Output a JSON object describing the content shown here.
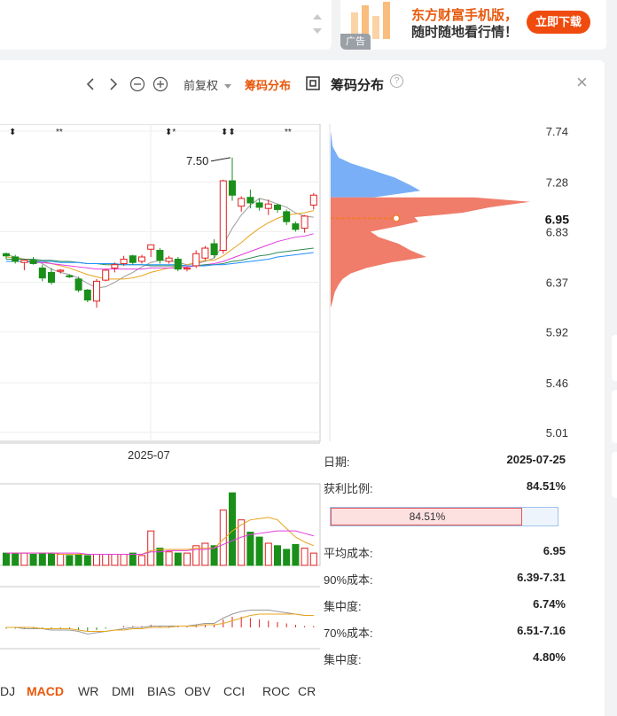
{
  "ad": {
    "line1": "东方财富手机版，",
    "line2": "随时随地看行情！",
    "button": "立即下载",
    "tag": "广告"
  },
  "toolbar": {
    "prev_icon": "chevron-left-icon",
    "next_icon": "chevron-right-icon",
    "zoom_out_icon": "zoom-out-icon",
    "zoom_in_icon": "zoom-in-icon",
    "adjust_label": "前复权",
    "chip_toggle_label": "筹码分布",
    "fullscreen_icon": "fullscreen-icon",
    "chip_title": "筹码分布",
    "help_icon": "?",
    "close_icon": "×",
    "accent_color": "#e8590c"
  },
  "chart_data": [
    {
      "type": "candlestick",
      "x_tick_labels": [
        "2025-07"
      ],
      "y_tick_labels": [
        "7.74",
        "7.28",
        "6.83",
        "6.37",
        "5.92",
        "5.46",
        "5.01"
      ],
      "current_price_label": "6.95",
      "annotation": "7.50",
      "ylim": [
        5.01,
        7.74
      ],
      "candles": [
        {
          "o": 6.63,
          "h": 6.64,
          "l": 6.58,
          "c": 6.61
        },
        {
          "o": 6.6,
          "h": 6.62,
          "l": 6.54,
          "c": 6.56
        },
        {
          "o": 6.55,
          "h": 6.58,
          "l": 6.48,
          "c": 6.57
        },
        {
          "o": 6.57,
          "h": 6.6,
          "l": 6.53,
          "c": 6.54
        },
        {
          "o": 6.5,
          "h": 6.53,
          "l": 6.38,
          "c": 6.41
        },
        {
          "o": 6.46,
          "h": 6.5,
          "l": 6.35,
          "c": 6.37
        },
        {
          "o": 6.47,
          "h": 6.49,
          "l": 6.45,
          "c": 6.48
        },
        {
          "o": 6.43,
          "h": 6.44,
          "l": 6.41,
          "c": 6.42
        },
        {
          "o": 6.4,
          "h": 6.42,
          "l": 6.28,
          "c": 6.3
        },
        {
          "o": 6.3,
          "h": 6.31,
          "l": 6.19,
          "c": 6.21
        },
        {
          "o": 6.2,
          "h": 6.4,
          "l": 6.14,
          "c": 6.38
        },
        {
          "o": 6.39,
          "h": 6.49,
          "l": 6.38,
          "c": 6.48
        },
        {
          "o": 6.5,
          "h": 6.55,
          "l": 6.46,
          "c": 6.53
        },
        {
          "o": 6.54,
          "h": 6.61,
          "l": 6.52,
          "c": 6.58
        },
        {
          "o": 6.61,
          "h": 6.62,
          "l": 6.53,
          "c": 6.55
        },
        {
          "o": 6.56,
          "h": 6.62,
          "l": 6.54,
          "c": 6.6
        },
        {
          "o": 6.67,
          "h": 6.71,
          "l": 6.6,
          "c": 6.71
        },
        {
          "o": 6.66,
          "h": 6.68,
          "l": 6.54,
          "c": 6.57
        },
        {
          "o": 6.56,
          "h": 6.61,
          "l": 6.54,
          "c": 6.59
        },
        {
          "o": 6.58,
          "h": 6.6,
          "l": 6.47,
          "c": 6.49
        },
        {
          "o": 6.49,
          "h": 6.51,
          "l": 6.47,
          "c": 6.5
        },
        {
          "o": 6.52,
          "h": 6.66,
          "l": 6.5,
          "c": 6.63
        },
        {
          "o": 6.59,
          "h": 6.7,
          "l": 6.57,
          "c": 6.68
        },
        {
          "o": 6.72,
          "h": 6.76,
          "l": 6.59,
          "c": 6.62
        },
        {
          "o": 6.66,
          "h": 7.3,
          "l": 6.63,
          "c": 7.29
        },
        {
          "o": 7.29,
          "h": 7.5,
          "l": 7.11,
          "c": 7.16
        },
        {
          "o": 7.06,
          "h": 7.15,
          "l": 7.01,
          "c": 7.13
        },
        {
          "o": 7.14,
          "h": 7.21,
          "l": 7.04,
          "c": 7.09
        },
        {
          "o": 7.09,
          "h": 7.13,
          "l": 7.02,
          "c": 7.05
        },
        {
          "o": 7.04,
          "h": 7.12,
          "l": 6.98,
          "c": 7.08
        },
        {
          "o": 7.07,
          "h": 7.08,
          "l": 7.0,
          "c": 7.03
        },
        {
          "o": 7.01,
          "h": 7.03,
          "l": 6.89,
          "c": 6.92
        },
        {
          "o": 6.9,
          "h": 6.92,
          "l": 6.83,
          "c": 6.85
        },
        {
          "o": 6.86,
          "h": 6.98,
          "l": 6.82,
          "c": 6.97
        },
        {
          "o": 7.07,
          "h": 7.18,
          "l": 7.03,
          "c": 7.16
        }
      ],
      "moving_averages": [
        {
          "color": "#999999",
          "values": [
            6.62,
            6.6,
            6.58,
            6.57,
            6.54,
            6.49,
            6.46,
            6.44,
            6.41,
            6.36,
            6.32,
            6.33,
            6.37,
            6.42,
            6.46,
            6.51,
            6.55,
            6.57,
            6.57,
            6.55,
            6.53,
            6.54,
            6.56,
            6.59,
            6.71,
            6.86,
            6.98,
            7.07,
            7.13,
            7.11,
            7.08,
            7.05,
            7.0,
            6.97,
            6.96
          ]
        },
        {
          "color": "#e8a41c",
          "values": [
            6.6,
            6.59,
            6.58,
            6.57,
            6.56,
            6.54,
            6.52,
            6.5,
            6.47,
            6.44,
            6.42,
            6.4,
            6.4,
            6.4,
            6.41,
            6.43,
            6.46,
            6.48,
            6.5,
            6.51,
            6.53,
            6.55,
            6.57,
            6.57,
            6.61,
            6.67,
            6.73,
            6.8,
            6.86,
            6.91,
            6.95,
            6.98,
            6.99,
            7.0,
            7.02
          ]
        },
        {
          "color": "#e43be0",
          "values": [
            6.56,
            6.56,
            6.56,
            6.55,
            6.55,
            6.54,
            6.53,
            6.52,
            6.51,
            6.5,
            6.49,
            6.49,
            6.49,
            6.49,
            6.49,
            6.49,
            6.5,
            6.5,
            6.5,
            6.5,
            6.51,
            6.52,
            6.53,
            6.54,
            6.56,
            6.59,
            6.62,
            6.65,
            6.68,
            6.71,
            6.74,
            6.76,
            6.78,
            6.79,
            6.81
          ]
        },
        {
          "color": "#2e8b57",
          "values": [
            6.58,
            6.58,
            6.58,
            6.58,
            6.57,
            6.57,
            6.56,
            6.56,
            6.55,
            6.54,
            6.54,
            6.53,
            6.53,
            6.53,
            6.53,
            6.53,
            6.52,
            6.52,
            6.52,
            6.52,
            6.52,
            6.52,
            6.53,
            6.53,
            6.54,
            6.56,
            6.57,
            6.59,
            6.61,
            6.62,
            6.64,
            6.65,
            6.66,
            6.67,
            6.68
          ]
        },
        {
          "color": "#1e90ff",
          "values": [
            6.56,
            6.56,
            6.56,
            6.56,
            6.56,
            6.56,
            6.55,
            6.55,
            6.55,
            6.54,
            6.54,
            6.54,
            6.54,
            6.53,
            6.53,
            6.53,
            6.53,
            6.53,
            6.53,
            6.53,
            6.52,
            6.52,
            6.52,
            6.53,
            6.53,
            6.54,
            6.55,
            6.56,
            6.57,
            6.58,
            6.6,
            6.61,
            6.62,
            6.63,
            6.64
          ]
        }
      ],
      "up_color": "#e02020",
      "down_color": "#1a8f1a"
    },
    {
      "type": "bar",
      "name": "volume",
      "values": [
        1.0,
        1.0,
        1.0,
        0.9,
        1.0,
        1.0,
        0.9,
        0.8,
        0.9,
        0.8,
        0.9,
        0.9,
        0.9,
        0.9,
        1.0,
        0.8,
        2.8,
        1.4,
        1.1,
        1.0,
        1.0,
        1.6,
        1.8,
        1.6,
        4.5,
        5.9,
        3.7,
        2.7,
        2.3,
        1.8,
        1.6,
        1.3,
        1.7,
        1.4,
        1.0
      ],
      "ma_lines": [
        {
          "color": "#e8a41c",
          "values": [
            1.0,
            1.0,
            1.0,
            1.0,
            1.0,
            1.0,
            0.9,
            0.9,
            0.9,
            0.9,
            0.9,
            0.9,
            0.9,
            0.9,
            0.9,
            0.9,
            1.2,
            1.3,
            1.3,
            1.3,
            1.3,
            1.4,
            1.4,
            1.4,
            2.1,
            2.8,
            3.3,
            3.7,
            3.8,
            3.9,
            3.7,
            3.0,
            2.3,
            1.9,
            1.6
          ]
        },
        {
          "color": "#e43be0",
          "values": [
            1.0,
            1.0,
            1.0,
            1.0,
            1.0,
            1.0,
            1.0,
            1.0,
            1.0,
            0.9,
            0.9,
            0.9,
            0.9,
            0.9,
            0.9,
            0.9,
            1.1,
            1.1,
            1.2,
            1.2,
            1.2,
            1.3,
            1.3,
            1.4,
            1.7,
            2.0,
            2.3,
            2.5,
            2.6,
            2.7,
            2.8,
            2.8,
            2.8,
            2.6,
            2.4
          ]
        }
      ]
    },
    {
      "type": "bar",
      "name": "MACD",
      "values": [
        -0.01,
        -0.01,
        -0.01,
        -0.01,
        -0.01,
        -0.01,
        -0.01,
        -0.01,
        -0.02,
        -0.03,
        -0.02,
        -0.01,
        0.0,
        0.01,
        0.01,
        0.01,
        0.02,
        0.01,
        0.01,
        0.01,
        0.01,
        0.02,
        0.02,
        0.02,
        0.06,
        0.08,
        0.08,
        0.07,
        0.06,
        0.05,
        0.04,
        0.03,
        0.02,
        0.01,
        0.01
      ],
      "dif": [
        0.0,
        0.0,
        -0.01,
        -0.01,
        -0.01,
        -0.02,
        -0.02,
        -0.02,
        -0.03,
        -0.05,
        -0.04,
        -0.03,
        -0.02,
        -0.01,
        0.0,
        0.0,
        0.01,
        0.01,
        0.01,
        0.01,
        0.01,
        0.02,
        0.03,
        0.03,
        0.07,
        0.1,
        0.12,
        0.13,
        0.13,
        0.13,
        0.12,
        0.11,
        0.1,
        0.09,
        0.09
      ],
      "dea": [
        0.0,
        0.0,
        0.0,
        0.0,
        -0.01,
        -0.01,
        -0.01,
        -0.01,
        -0.02,
        -0.03,
        -0.03,
        -0.03,
        -0.02,
        -0.02,
        -0.01,
        -0.01,
        0.0,
        0.0,
        0.0,
        0.01,
        0.01,
        0.01,
        0.02,
        0.02,
        0.03,
        0.05,
        0.07,
        0.09,
        0.1,
        0.1,
        0.1,
        0.1,
        0.1,
        0.09,
        0.09
      ]
    },
    {
      "type": "area",
      "name": "筹码分布",
      "profile": [
        {
          "p": 7.74,
          "w": 0.0
        },
        {
          "p": 7.6,
          "w": 0.01
        },
        {
          "p": 7.5,
          "w": 0.04
        },
        {
          "p": 7.45,
          "w": 0.1
        },
        {
          "p": 7.38,
          "w": 0.22
        },
        {
          "p": 7.32,
          "w": 0.32
        },
        {
          "p": 7.25,
          "w": 0.4
        },
        {
          "p": 7.2,
          "w": 0.45
        },
        {
          "p": 7.14,
          "w": 0.72
        },
        {
          "p": 7.1,
          "w": 1.0
        },
        {
          "p": 7.05,
          "w": 0.8
        },
        {
          "p": 7.0,
          "w": 0.66
        },
        {
          "p": 6.96,
          "w": 0.42
        },
        {
          "p": 6.92,
          "w": 0.44
        },
        {
          "p": 6.88,
          "w": 0.34
        },
        {
          "p": 6.83,
          "w": 0.2
        },
        {
          "p": 6.78,
          "w": 0.24
        },
        {
          "p": 6.72,
          "w": 0.34
        },
        {
          "p": 6.66,
          "w": 0.4
        },
        {
          "p": 6.6,
          "w": 0.48
        },
        {
          "p": 6.55,
          "w": 0.3
        },
        {
          "p": 6.5,
          "w": 0.18
        },
        {
          "p": 6.45,
          "w": 0.1
        },
        {
          "p": 6.4,
          "w": 0.06
        },
        {
          "p": 6.35,
          "w": 0.04
        },
        {
          "p": 6.28,
          "w": 0.02
        },
        {
          "p": 6.2,
          "w": 0.01
        },
        {
          "p": 6.14,
          "w": 0.0
        }
      ],
      "profit_color": "#6aa6f5",
      "loss_color": "#ee6e5a",
      "current_price": 6.95,
      "current_price_color": "#f07a22"
    }
  ],
  "stats": {
    "date_label": "日期:",
    "date_value": "2025-07-25",
    "profit_label": "获利比例:",
    "profit_value": "84.51%",
    "profit_bar_text": "84.51%",
    "profit_ratio": 0.8451,
    "avg_label": "平均成本:",
    "avg_value": "6.95",
    "c90_label": "90%成本:",
    "c90_value": "6.39-7.31",
    "conc90_label": "集中度:",
    "conc90_value": "6.74%",
    "c70_label": "70%成本:",
    "c70_value": "6.51-7.16",
    "conc70_label": "集中度:",
    "conc70_value": "4.80%"
  },
  "tabs": [
    "DJ",
    "MACD",
    "WR",
    "DMI",
    "BIAS",
    "OBV",
    "CCI",
    "ROC",
    "CR"
  ],
  "active_tab": "MACD"
}
